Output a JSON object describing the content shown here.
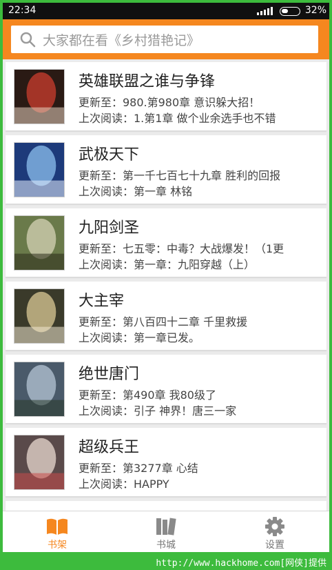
{
  "status_bar": {
    "time": "22:34",
    "battery_percent": "32%"
  },
  "search": {
    "placeholder": "大家都在看《乡村猎艳记》",
    "icon": "search-icon"
  },
  "books": [
    {
      "title": "英雄联盟之谁与争锋",
      "update": "更新至：980.第980章 意识躲大招！",
      "last_read": "上次阅读：1.第1章 做个业余选手也不错",
      "cover_colors": [
        "#2a1a14",
        "#b83a2a",
        "#e8d4c0"
      ]
    },
    {
      "title": "武极天下",
      "update": "更新至：第一千七百七十九章 胜利的回报",
      "last_read": "上次阅读：第一章 林铭",
      "cover_colors": [
        "#1d3a7a",
        "#7fb0e0",
        "#e8f0ff"
      ]
    },
    {
      "title": "九阳剑圣",
      "update": "更新至：七五零：中毒？大战爆发！（1更",
      "last_read": "上次阅读：第一章：九阳穿越（上）",
      "cover_colors": [
        "#6a7a4a",
        "#c8c8a8",
        "#2a2a1a"
      ]
    },
    {
      "title": "大主宰",
      "update": "更新至：第八百四十二章 千里救援",
      "last_read": "上次阅读：第一章已发。",
      "cover_colors": [
        "#3a3a2a",
        "#c8b888",
        "#f0e8d0"
      ]
    },
    {
      "title": "绝世唐门",
      "update": "更新至：第490章 我80级了",
      "last_read": "上次阅读：引子 神界！唐三一家",
      "cover_colors": [
        "#4a5a6a",
        "#a8b8c8",
        "#2a3a2a"
      ]
    },
    {
      "title": "超级兵王",
      "update": "更新至：第3277章 心结",
      "last_read": "上次阅读：HAPPY",
      "cover_colors": [
        "#5a4a4a",
        "#d8c8c0",
        "#c84a4a"
      ]
    }
  ],
  "bottom_nav": [
    {
      "label": "书架",
      "icon": "bookshelf-icon",
      "active": true
    },
    {
      "label": "书城",
      "icon": "bookstore-icon",
      "active": false
    },
    {
      "label": "设置",
      "icon": "gear-icon",
      "active": false
    }
  ],
  "watermark": "http://www.hackhome.com[网侠]提供",
  "colors": {
    "accent": "#f5871f",
    "frame": "#3dbb3d"
  }
}
